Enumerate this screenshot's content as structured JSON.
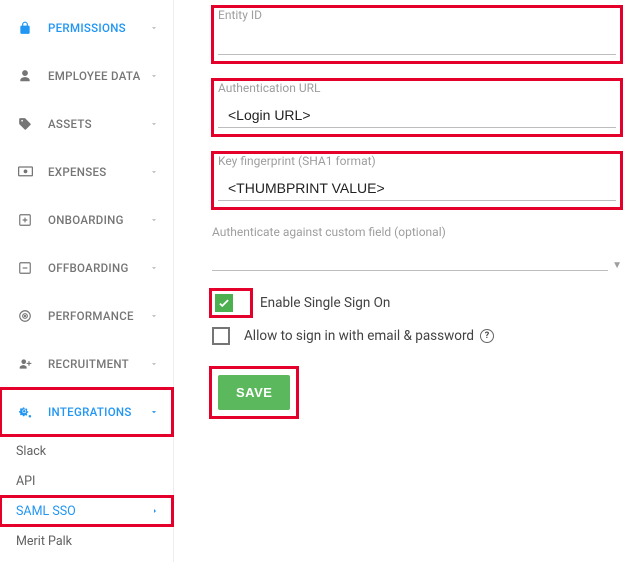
{
  "sidebar": {
    "items": [
      {
        "label": "PERMISSIONS"
      },
      {
        "label": "EMPLOYEE DATA"
      },
      {
        "label": "ASSETS"
      },
      {
        "label": "EXPENSES"
      },
      {
        "label": "ONBOARDING"
      },
      {
        "label": "OFFBOARDING"
      },
      {
        "label": "PERFORMANCE"
      },
      {
        "label": "RECRUITMENT"
      },
      {
        "label": "INTEGRATIONS"
      }
    ],
    "sub": [
      {
        "label": "Slack"
      },
      {
        "label": "API"
      },
      {
        "label": "SAML SSO"
      },
      {
        "label": "Merit Palk"
      }
    ]
  },
  "form": {
    "entity_id_label": "Entity ID",
    "entity_id_value": "",
    "auth_url_label": "Authentication URL",
    "auth_url_value": "<Login URL>",
    "fingerprint_label": "Key fingerprint (SHA1 format)",
    "fingerprint_value": "<THUMBPRINT VALUE>",
    "custom_field_label": "Authenticate against custom field (optional)",
    "enable_sso_label": "Enable Single Sign On",
    "allow_email_label": "Allow to sign in with email & password",
    "save_label": "SAVE"
  }
}
